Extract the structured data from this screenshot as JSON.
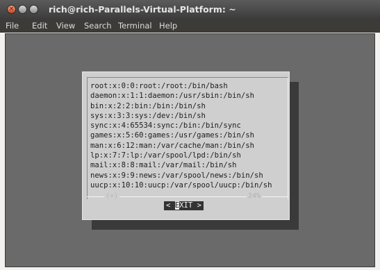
{
  "window": {
    "title": "rich@rich-Parallels-Virtual-Platform: ~"
  },
  "menu": [
    "File",
    "Edit",
    "View",
    "Search",
    "Terminal",
    "Help"
  ],
  "dialog": {
    "lines": [
      "root:x:0:0:root:/root:/bin/bash",
      "daemon:x:1:1:daemon:/usr/sbin:/bin/sh",
      "bin:x:2:2:bin:/bin:/bin/sh",
      "sys:x:3:3:sys:/dev:/bin/sh",
      "sync:x:4:65534:sync:/bin:/bin/sync",
      "games:x:5:60:games:/usr/games:/bin/sh",
      "man:x:6:12:man:/var/cache/man:/bin/sh",
      "lp:x:7:7:lp:/var/spool/lpd:/bin/sh",
      "mail:x:8:8:mail:/var/mail:/bin/sh",
      "news:x:9:9:news:/var/spool/news:/bin/sh",
      "uucp:x:10:10:uucp:/var/spool/uucp:/bin/sh"
    ],
    "scroll_indicator": "(+)",
    "percent": "24%",
    "exit_button": {
      "left": "< ",
      "hotkey": "E",
      "rest": "XIT >"
    }
  }
}
